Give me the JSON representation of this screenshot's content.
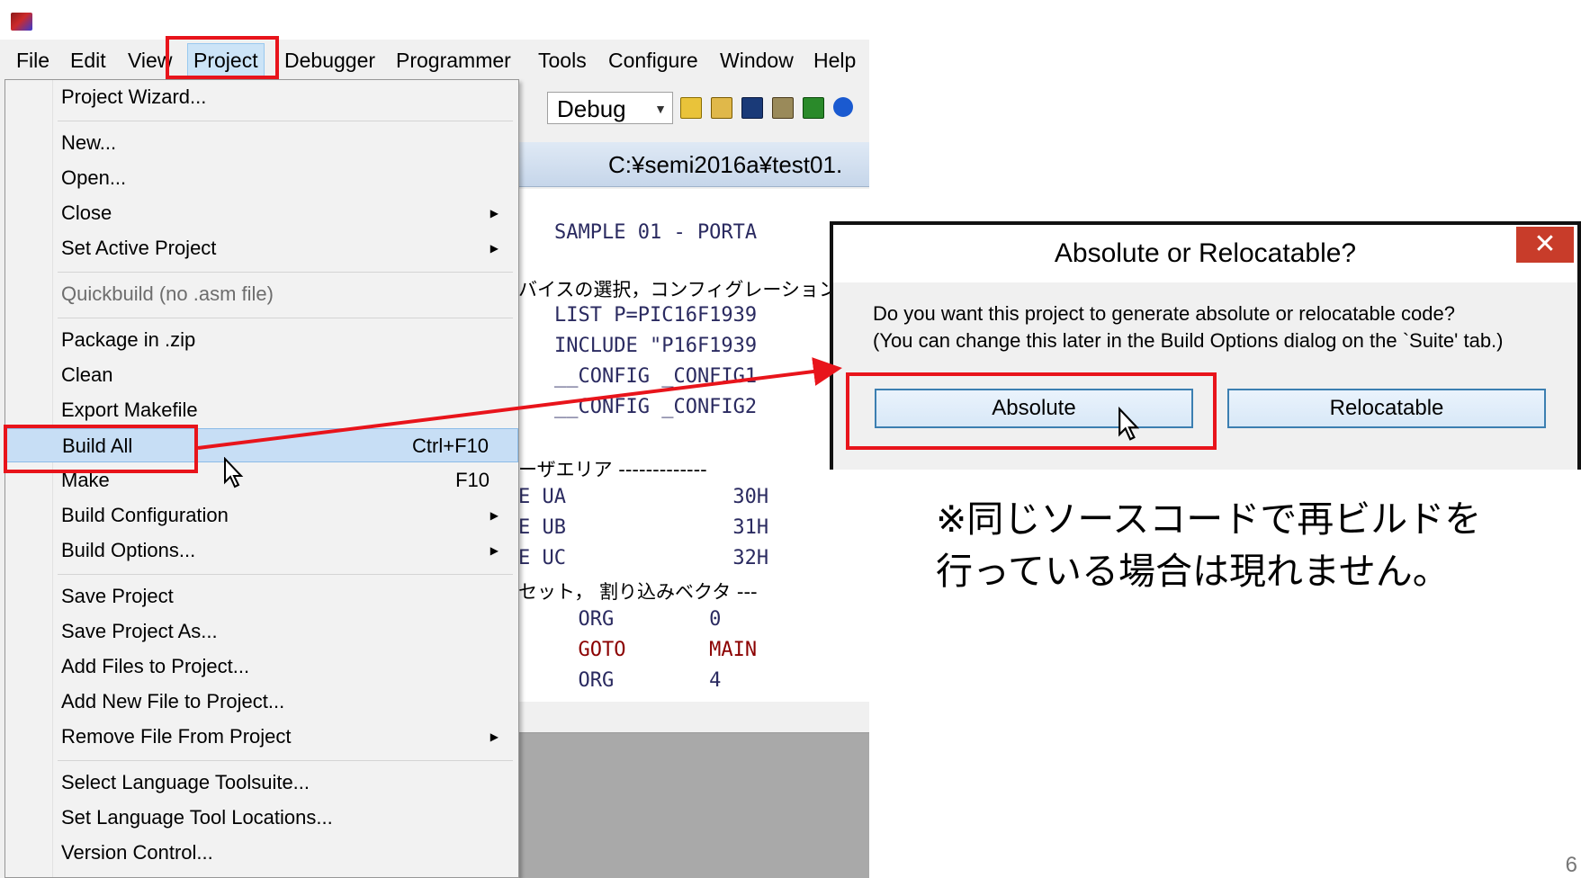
{
  "menubar": {
    "items": [
      "File",
      "Edit",
      "View",
      "Project",
      "Debugger",
      "Programmer",
      "Tools",
      "Configure",
      "Window",
      "Help"
    ],
    "active": "Project"
  },
  "toolbar": {
    "config_value": "Debug"
  },
  "editor": {
    "title": "C:¥semi2016a¥test01.",
    "lines": [
      {
        "text": "SAMPLE 01 - PORTA",
        "style": "code"
      },
      {
        "text": "バイスの選択，コンフィグレーション",
        "style": "jp"
      },
      {
        "text": "LIST P=PIC16F1939",
        "style": "code"
      },
      {
        "text": "INCLUDE \"P16F1939",
        "style": "code"
      },
      {
        "text": "__CONFIG _CONFIG1",
        "style": "code"
      },
      {
        "text": "__CONFIG _CONFIG2",
        "style": "code"
      },
      {
        "text": "ーザエリア -------------",
        "style": "jp"
      },
      {
        "text": "E UA              30H",
        "style": "code"
      },
      {
        "text": "E UB              31H",
        "style": "code"
      },
      {
        "text": "E UC              32H",
        "style": "code"
      },
      {
        "text": "セット， 割り込みベクタ ---",
        "style": "jp"
      },
      {
        "text": "  ORG        0",
        "style": "code"
      },
      {
        "text": "  GOTO       MAIN",
        "style": "code"
      },
      {
        "text": "  ORG        4",
        "style": "code"
      }
    ]
  },
  "project_menu": {
    "items": [
      {
        "label": "Project Wizard..."
      },
      {
        "label": "New..."
      },
      {
        "label": "Open..."
      },
      {
        "label": "Close",
        "submenu": true
      },
      {
        "label": "Set Active Project",
        "submenu": true
      },
      {
        "label": "Quickbuild (no .asm file)",
        "disabled": true
      },
      {
        "label": "Package in .zip"
      },
      {
        "label": "Clean"
      },
      {
        "label": "Export Makefile"
      },
      {
        "label": "Build All",
        "shortcut": "Ctrl+F10",
        "highlighted": true
      },
      {
        "label": "Make",
        "shortcut": "F10"
      },
      {
        "label": "Build Configuration",
        "submenu": true
      },
      {
        "label": "Build Options...",
        "submenu": true
      },
      {
        "label": "Save Project"
      },
      {
        "label": "Save Project As..."
      },
      {
        "label": "Add Files to Project..."
      },
      {
        "label": "Add New File to Project..."
      },
      {
        "label": "Remove File From Project",
        "submenu": true
      },
      {
        "label": "Select Language Toolsuite..."
      },
      {
        "label": "Set Language Tool Locations..."
      },
      {
        "label": "Version Control..."
      }
    ]
  },
  "dialog": {
    "title": "Absolute or Relocatable?",
    "close_label": "✕",
    "message_line1": "Do you want this project to generate absolute or relocatable code?",
    "message_line2": "(You can change this later in the Build Options dialog on the `Suite' tab.)",
    "button_absolute": "Absolute",
    "button_relocatable": "Relocatable"
  },
  "annotation": {
    "note_line1": "※同じソースコードで再ビルドを",
    "note_line2": "行っている場合は現れません。",
    "highlight_color": "#e8141b"
  },
  "page_number": "6"
}
